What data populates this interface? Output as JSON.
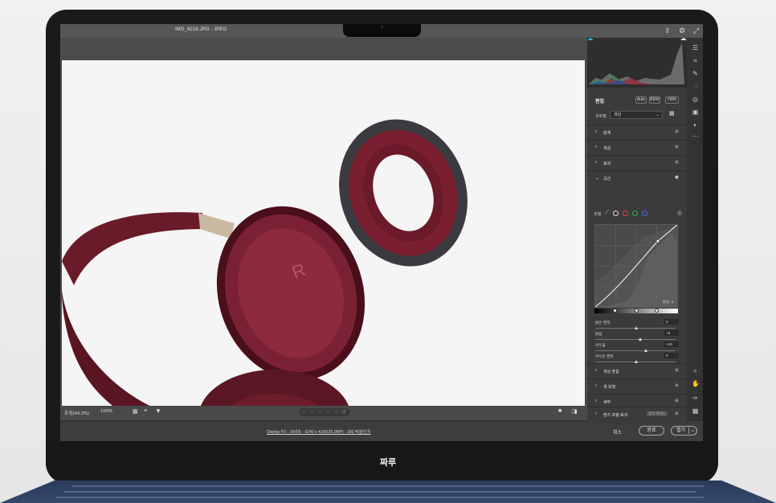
{
  "window": {
    "title": "IMG_6216.JPG  -  JPEG"
  },
  "bottom_bar": {
    "zoom_label": "조정(44.3%)",
    "zoom_percent": "100%",
    "rating_stars": "☆ ☆ ☆ ☆ ☆  ⊘"
  },
  "footer": {
    "info": "Display P3 - 16비트 - 6240 x 4160(26.0MP) - 300 픽셀/인치",
    "cancel": "취소",
    "done": "완료",
    "open": "열기"
  },
  "panel": {
    "edit_title": "편집",
    "auto": "Auto",
    "bw": "B&W",
    "hdr": "HDR",
    "profile_label": "프로필",
    "profile_value": "색상",
    "sections": [
      {
        "label": "밝게",
        "expanded": false
      },
      {
        "label": "색상",
        "expanded": false
      },
      {
        "label": "효과",
        "expanded": false
      },
      {
        "label": "곡선",
        "expanded": true
      }
    ],
    "curve": {
      "adjust_label": "조정",
      "shadow_readout": "밝음: 0",
      "sliders": [
        {
          "label": "밝은 영역",
          "value": "0",
          "position": 0.5
        },
        {
          "label": "밝음",
          "value": "+9",
          "position": 0.55
        },
        {
          "label": "어두움",
          "value": "+25",
          "position": 0.62
        },
        {
          "label": "어두운 영역",
          "value": "0",
          "position": 0.5
        }
      ]
    },
    "more_sections": [
      {
        "label": "색상 혼합"
      },
      {
        "label": "색 보정"
      },
      {
        "label": "세부"
      },
      {
        "label": "광학"
      },
      {
        "label": "렌즈 흐림 효과",
        "badge": "얼리 액세스"
      }
    ]
  },
  "brand": "짜루",
  "colors": {
    "accent_cyan": "#17c3d6",
    "burgundy": "#6d1e2c"
  }
}
